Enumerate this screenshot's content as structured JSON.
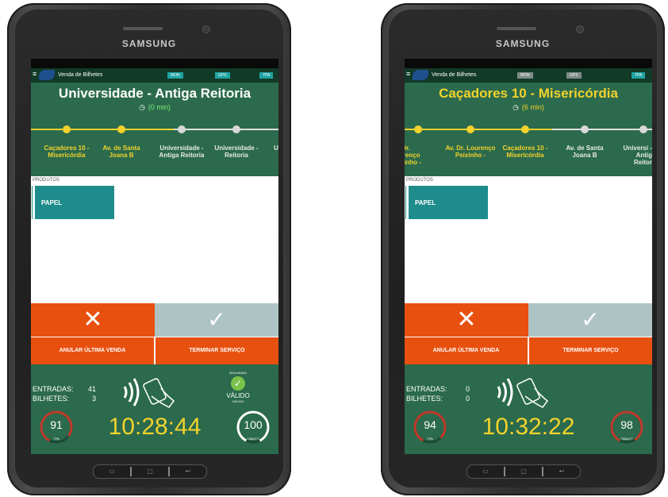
{
  "devices": [
    {
      "brand": "SAMSUNG",
      "app_title": "Venda de Bilhetes",
      "badges": [
        {
          "label": "MON",
          "style": "teal"
        },
        {
          "label": "GPS",
          "style": "teal"
        },
        {
          "label": "TPA",
          "style": "teal"
        }
      ],
      "route_title": "Universidade - Antiga Reitoria",
      "route_title_color": "#ffffff",
      "elapsed": "(0 min)",
      "elapsed_color": "#7ef07e",
      "stops": [
        {
          "label": "Caçadores 10 - Misericórdia",
          "state": "passed"
        },
        {
          "label": "Av. de Santa Joana B",
          "state": "passed"
        },
        {
          "label": "Universidade - Antiga Reitoria",
          "state": "upcoming"
        },
        {
          "label": "Universidade - Reitoria",
          "state": "upcoming"
        },
        {
          "label": "U",
          "state": "upcoming"
        }
      ],
      "products_title": "PRODUTOS",
      "product": "PAPEL",
      "cancel_icon": "✕",
      "confirm_icon": "✓",
      "btn_anular": "ANULAR ÚLTIMA VENDA",
      "btn_terminar": "TERMINAR SERVIÇO",
      "entradas_label": "ENTRADAS:",
      "entradas_value": "41",
      "bilhetes_label": "BILHETES:",
      "bilhetes_value": "3",
      "validation": {
        "code": "3531440601",
        "status": "VÁLIDO",
        "sub": "VÁLIDO"
      },
      "tpa_battery": "91",
      "tpa_battery_level": 0.91,
      "tpa_label": "TPA",
      "clock": "10:28:44",
      "tablet_battery": "100",
      "tablet_battery_level": 1.0,
      "tablet_label": "TABLET"
    },
    {
      "brand": "SAMSUNG",
      "app_title": "Venda de Bilhetes",
      "badges": [
        {
          "label": "MON",
          "style": "gray"
        },
        {
          "label": "GPS",
          "style": "gray"
        },
        {
          "label": "TPA",
          "style": "teal"
        }
      ],
      "route_title": "Caçadores 10 - Misericórdia",
      "route_title_color": "#f3d22c",
      "elapsed": "(6 min)",
      "elapsed_color": "#f3d22c",
      "stops": [
        {
          "label": "v. Dr. ourenço eixinho -",
          "state": "passed"
        },
        {
          "label": "Av. Dr. Lourenço Peixinho -",
          "state": "passed"
        },
        {
          "label": "Caçadores 10 - Misericórdia",
          "state": "passed"
        },
        {
          "label": "Av. de Santa Joana B",
          "state": "upcoming"
        },
        {
          "label": "Universi - Antig Reitor",
          "state": "upcoming"
        }
      ],
      "products_title": "PRODUTOS",
      "product": "PAPEL",
      "cancel_icon": "✕",
      "confirm_icon": "✓",
      "btn_anular": "ANULAR ÚLTIMA VENDA",
      "btn_terminar": "TERMINAR SERVIÇO",
      "entradas_label": "ENTRADAS:",
      "entradas_value": "0",
      "bilhetes_label": "BILHETES:",
      "bilhetes_value": "0",
      "tpa_battery": "94",
      "tpa_battery_level": 0.94,
      "tpa_label": "TPA",
      "clock": "10:32:22",
      "tablet_battery": "98",
      "tablet_battery_level": 0.98,
      "tablet_label": "TABLET"
    }
  ]
}
